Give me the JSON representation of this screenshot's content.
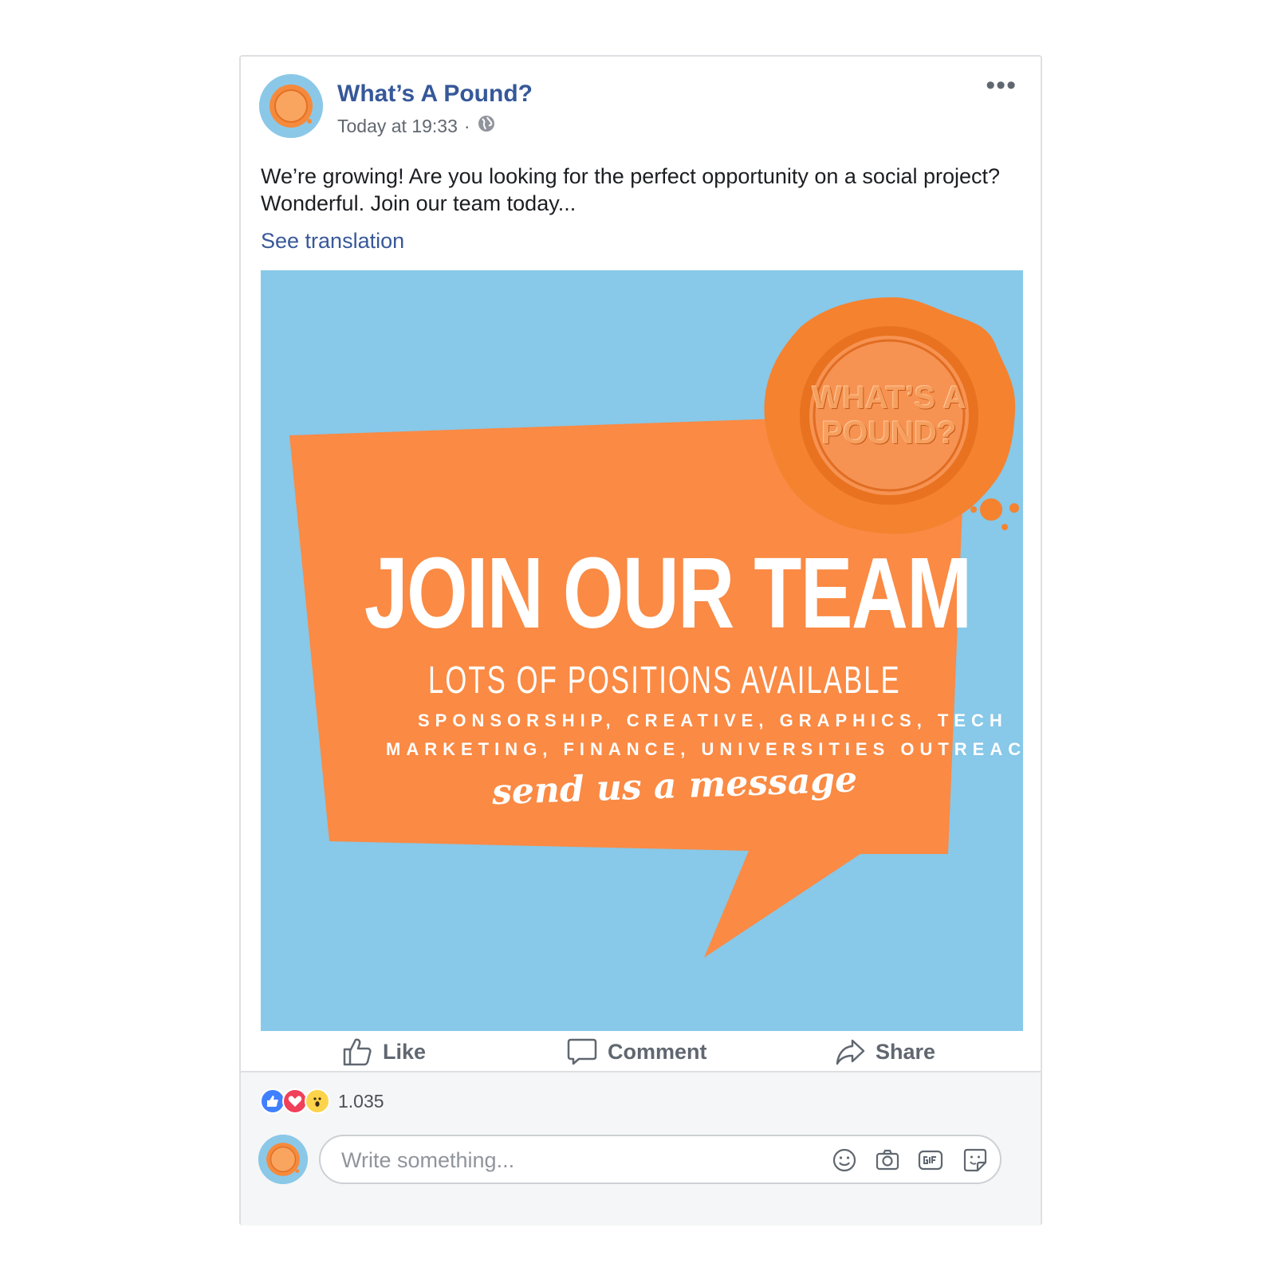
{
  "post": {
    "page_name": "What’s A Pound?",
    "timestamp": "Today at 19:33",
    "separator": "·",
    "visibility_icon": "globe-icon",
    "more_label": "•••",
    "text": "We’re growing! Are you looking for the perfect opportunity on a social project? Wonderful. Join our team today...",
    "see_translation": "See translation"
  },
  "image": {
    "seal_text": "WHAT’S A POUND?",
    "headline": "JOIN OUR TEAM",
    "subhead": "LOTS OF POSITIONS AVAILABLE",
    "roles_line1": "SPONSORSHIP, CREATIVE, GRAPHICS, TECH",
    "roles_line2": "MARKETING, FINANCE, UNIVERSITIES OUTREACH",
    "cta": "send us a message"
  },
  "actions": {
    "like": "Like",
    "comment": "Comment",
    "share": "Share"
  },
  "reactions": {
    "count": "1.035",
    "types": [
      "like",
      "love",
      "wow"
    ]
  },
  "comment": {
    "placeholder": "Write something...",
    "value": "",
    "tools": [
      "emoji-icon",
      "camera-icon",
      "gif-icon",
      "sticker-icon"
    ]
  },
  "colors": {
    "brand_blue": "#365899",
    "image_bg": "#88c8e8",
    "orange": "#fa8a44",
    "like_blue": "#4080ff",
    "love_red": "#f0405a",
    "wow_yellow": "#fcd34a"
  }
}
